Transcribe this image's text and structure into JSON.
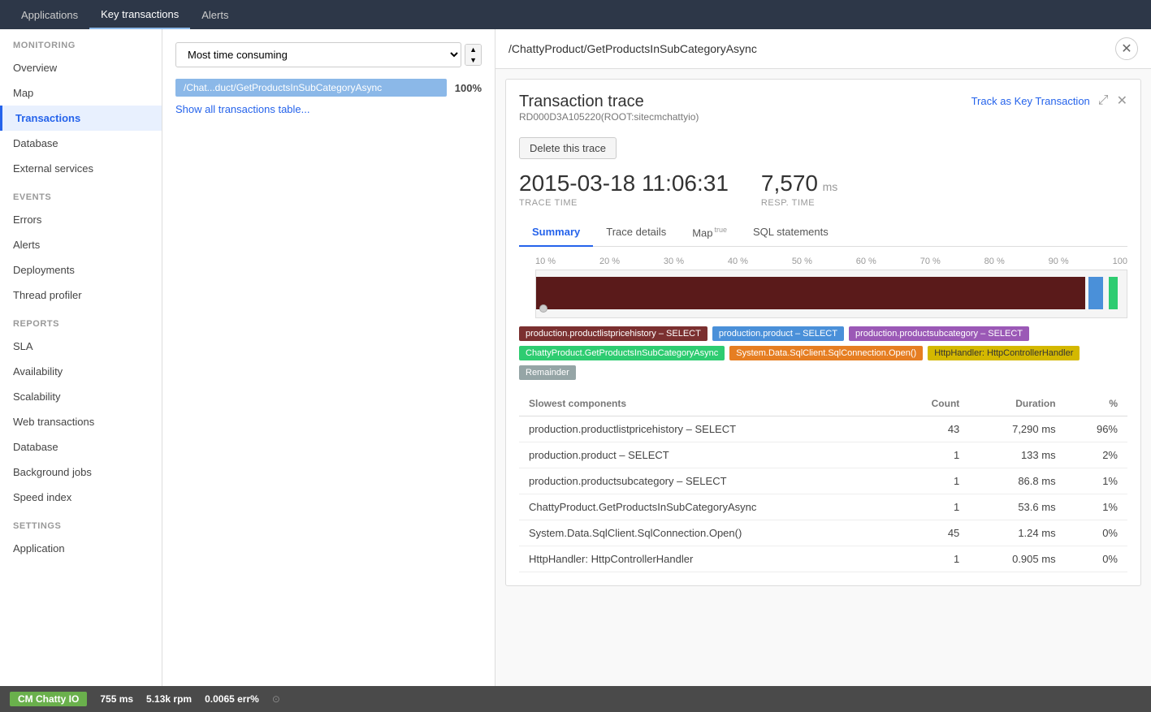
{
  "topNav": {
    "items": [
      {
        "label": "Applications",
        "active": false
      },
      {
        "label": "Key transactions",
        "active": true
      },
      {
        "label": "Alerts",
        "active": false
      }
    ]
  },
  "sidebar": {
    "sections": [
      {
        "label": "MONITORING",
        "items": [
          {
            "id": "overview",
            "label": "Overview",
            "active": false
          },
          {
            "id": "map",
            "label": "Map",
            "active": false
          },
          {
            "id": "transactions",
            "label": "Transactions",
            "active": true
          }
        ]
      },
      {
        "label": "",
        "items": [
          {
            "id": "database",
            "label": "Database",
            "active": false
          },
          {
            "id": "external-services",
            "label": "External services",
            "active": false
          }
        ]
      },
      {
        "label": "EVENTS",
        "items": [
          {
            "id": "errors",
            "label": "Errors",
            "active": false
          },
          {
            "id": "alerts",
            "label": "Alerts",
            "active": false
          },
          {
            "id": "deployments",
            "label": "Deployments",
            "active": false
          },
          {
            "id": "thread-profiler",
            "label": "Thread profiler",
            "active": false
          }
        ]
      },
      {
        "label": "REPORTS",
        "items": [
          {
            "id": "sla",
            "label": "SLA",
            "active": false
          },
          {
            "id": "availability",
            "label": "Availability",
            "active": false
          },
          {
            "id": "scalability",
            "label": "Scalability",
            "active": false
          },
          {
            "id": "web-transactions",
            "label": "Web transactions",
            "active": false
          },
          {
            "id": "database-report",
            "label": "Database",
            "active": false
          },
          {
            "id": "background-jobs",
            "label": "Background jobs",
            "active": false
          },
          {
            "id": "speed-index",
            "label": "Speed index",
            "active": false
          }
        ]
      },
      {
        "label": "SETTINGS",
        "items": [
          {
            "id": "application",
            "label": "Application",
            "active": false
          }
        ]
      }
    ]
  },
  "leftPanel": {
    "filterValue": "Most time consuming",
    "transactionBar": {
      "label": "/Chat...duct/GetProductsInSubCategoryAsync",
      "pct": "100%"
    },
    "showAllLink": "Show all transactions table..."
  },
  "traceUrl": "/ChattyProduct/GetProductsInSubCategoryAsync",
  "tracePanel": {
    "title": "Transaction trace",
    "trackLabel": "Track as Key Transaction",
    "traceId": "RD000D3A105220(ROOT:sitecmchattyio)",
    "deleteLabel": "Delete this trace",
    "stats": {
      "traceTime": {
        "value": "2015-03-18 11:06:31",
        "label": "TRACE TIME"
      },
      "respTime": {
        "value": "7,570",
        "unit": "ms",
        "label": "RESP. TIME"
      }
    },
    "tabs": [
      {
        "id": "summary",
        "label": "Summary",
        "active": true
      },
      {
        "id": "trace-details",
        "label": "Trace details",
        "active": false
      },
      {
        "id": "map",
        "label": "Map",
        "beta": true,
        "active": false
      },
      {
        "id": "sql-statements",
        "label": "SQL statements",
        "active": false
      }
    ],
    "timelineAxis": [
      "10 %",
      "20 %",
      "30 %",
      "40 %",
      "50 %",
      "60 %",
      "70 %",
      "80 %",
      "90 %",
      "100"
    ],
    "legend": [
      {
        "label": "production.productlistpricehistory – SELECT",
        "color": "#7b3030"
      },
      {
        "label": "production.product – SELECT",
        "color": "#4a90d9"
      },
      {
        "label": "production.productsubcategory – SELECT",
        "color": "#9b59b6"
      },
      {
        "label": "ChattyProduct.GetProductsInSubCategoryAsync",
        "color": "#2ecc71"
      },
      {
        "label": "System.Data.SqlClient.SqlConnection.Open()",
        "color": "#e67e22"
      },
      {
        "label": "HttpHandler: HttpControllerHandler",
        "color": "#f1c40f"
      },
      {
        "label": "Remainder",
        "color": "#95a5a6"
      }
    ],
    "slowestComponents": {
      "title": "Slowest components",
      "headers": [
        "",
        "Count",
        "Duration",
        "%"
      ],
      "rows": [
        {
          "name": "production.productlistpricehistory – SELECT",
          "count": "43",
          "duration": "7,290 ms",
          "pct": "96%"
        },
        {
          "name": "production.product – SELECT",
          "count": "1",
          "duration": "133 ms",
          "pct": "2%"
        },
        {
          "name": "production.productsubcategory – SELECT",
          "count": "1",
          "duration": "86.8 ms",
          "pct": "1%"
        },
        {
          "name": "ChattyProduct.GetProductsInSubCategoryAsync",
          "count": "1",
          "duration": "53.6 ms",
          "pct": "1%"
        },
        {
          "name": "System.Data.SqlClient.SqlConnection.Open()",
          "count": "45",
          "duration": "1.24 ms",
          "pct": "0%"
        },
        {
          "name": "HttpHandler: HttpControllerHandler",
          "count": "1",
          "duration": "0.905 ms",
          "pct": "0%"
        }
      ]
    }
  },
  "footer": {
    "appName": "CM Chatty IO",
    "stats": [
      {
        "label": "755 ms",
        "key": "ms"
      },
      {
        "label": "5.13k rpm",
        "key": "rpm"
      },
      {
        "label": "0.0065 err%",
        "key": "err"
      }
    ]
  }
}
